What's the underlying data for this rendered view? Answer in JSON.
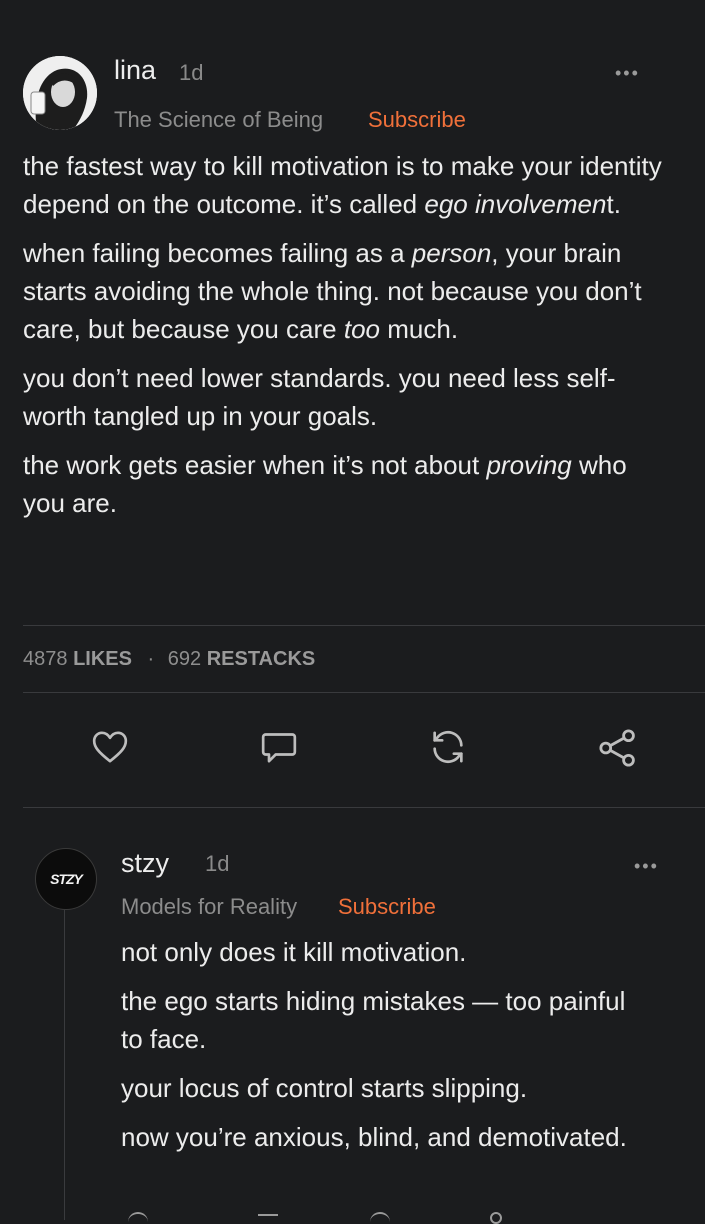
{
  "post": {
    "author": "lina",
    "time": "1d",
    "publication": "The Science of Being",
    "subscribe": "Subscribe",
    "more": "•••",
    "paragraphs": [
      [
        {
          "t": "the fastest way to kill motivation is to make your identity depend on the outcome. it’s called "
        },
        {
          "t": "ego involvemen",
          "i": true
        },
        {
          "t": "t."
        }
      ],
      [
        {
          "t": "when failing becomes failing as a "
        },
        {
          "t": "person",
          "i": true
        },
        {
          "t": ", your brain starts avoiding the whole thing. not because you don’t care, but because you care "
        },
        {
          "t": "too",
          "i": true
        },
        {
          "t": " much."
        }
      ],
      [
        {
          "t": "you don’t need lower standards. you need less self-worth tangled up in your goals."
        }
      ],
      [
        {
          "t": "the work gets easier when it’s not about "
        },
        {
          "t": "proving",
          "i": true
        },
        {
          "t": " who you are."
        }
      ]
    ],
    "likes_count": "4878",
    "likes_label": "LIKES",
    "separator": "·",
    "restacks_count": "692",
    "restacks_label": "RESTACKS",
    "actions": [
      "heart-icon",
      "comment-icon",
      "restack-icon",
      "share-icon"
    ]
  },
  "reply": {
    "author": "stzy",
    "avatar_text": "STZY",
    "time": "1d",
    "publication": "Models for Reality",
    "subscribe": "Subscribe",
    "more": "•••",
    "paragraphs": [
      "not only does it kill motivation.",
      "the ego starts hiding mistakes — too painful to face.",
      "your locus of control starts slipping.",
      "now you’re anxious, blind, and demotivated."
    ]
  },
  "colors": {
    "background": "#1b1c1e",
    "accent": "#f0703a",
    "text": "#ececec",
    "muted": "#8c8c8c"
  }
}
